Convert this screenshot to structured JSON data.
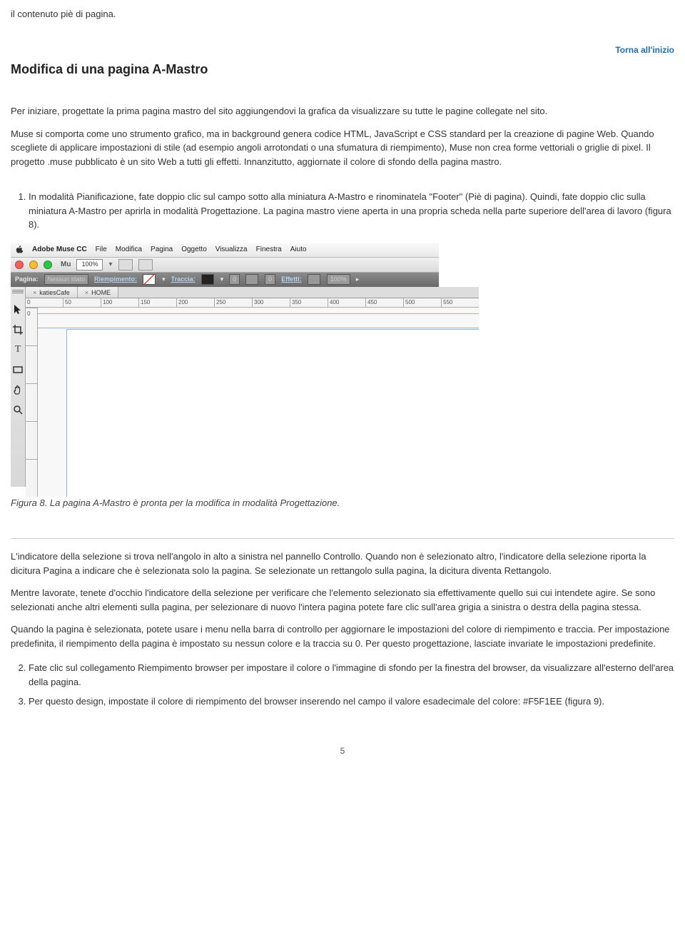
{
  "intro_line": "il contenuto piè di pagina.",
  "back_link": "Torna all'inizio",
  "heading": "Modifica di una pagina A-Mastro",
  "para1": "Per iniziare, progettate la prima pagina mastro del sito aggiungendovi la grafica da visualizzare su tutte le pagine collegate nel sito.",
  "para2": "Muse si comporta come uno strumento grafico, ma in background genera codice HTML, JavaScript e CSS standard per la creazione di pagine Web. Quando scegliete di applicare impostazioni di stile (ad esempio angoli arrotondati o una sfumatura di riempimento), Muse non crea forme vettoriali o griglie di pixel. Il progetto .muse pubblicato è un sito Web a tutti gli effetti. Innanzitutto, aggiornate il colore di sfondo della pagina mastro.",
  "step1": "In modalità Pianificazione, fate doppio clic sul campo sotto alla miniatura A-Mastro e rinominatela \"Footer\" (Piè di pagina). Quindi, fate doppio clic sulla miniatura A-Mastro per aprirla in modalità Progettazione. La pagina mastro viene aperta in una propria scheda nella parte superiore dell'area di lavoro (figura 8).",
  "caption": "Figura 8. La pagina A-Mastro è pronta per la modifica in modalità Progettazione.",
  "para3": "L'indicatore della selezione si trova nell'angolo in alto a sinistra nel pannello Controllo. Quando non è selezionato altro, l'indicatore della selezione riporta la dicitura Pagina a indicare che è selezionata solo la pagina. Se selezionate un rettangolo sulla pagina, la dicitura diventa Rettangolo.",
  "para4": "Mentre lavorate, tenete d'occhio l'indicatore della selezione per verificare che l'elemento selezionato sia effettivamente quello sui cui intendete agire. Se sono selezionati anche altri elementi sulla pagina, per selezionare di nuovo l'intera pagina potete fare clic sull'area grigia a sinistra o destra della pagina stessa.",
  "para5": "Quando la pagina è selezionata, potete usare i menu nella barra di controllo per aggiornare le impostazioni del colore di riempimento e traccia. Per impostazione predefinita, il riempimento della pagina è impostato su nessun colore e la traccia su 0. Per questo progettazione, lasciate invariate le impostazioni predefinite.",
  "step2": "Fate clic sul collegamento Riempimento browser per impostare il colore o l'immagine di sfondo per la finestra del browser, da visualizzare all'esterno dell'area della pagina.",
  "step3": "Per questo design, impostate il colore di riempimento del browser inserendo nel campo il valore esadecimale del colore: #F5F1EE (figura 9).",
  "page_number": "5",
  "muse_ui": {
    "app_title": "Adobe Muse CC",
    "menus": [
      "File",
      "Modifica",
      "Pagina",
      "Oggetto",
      "Visualizza",
      "Finestra",
      "Aiuto"
    ],
    "mu": "Mu",
    "zoom": "100%",
    "opt_pagina": "Pagina:",
    "opt_nessun": "Nessun stato",
    "opt_riemp": "Riempimento:",
    "opt_traccia": "Traccia:",
    "opt_traccia_val": "0",
    "opt_offset": "0",
    "opt_effetti": "Effetti:",
    "opt_effetti_val": "100%",
    "tab1": "katiesCafe",
    "tab2": "HOME",
    "ruler_h": [
      "0",
      "50",
      "100",
      "150",
      "200",
      "250",
      "300",
      "350",
      "400",
      "450",
      "500",
      "550"
    ],
    "ruler_v": [
      "0",
      "",
      "",
      "",
      ""
    ]
  }
}
